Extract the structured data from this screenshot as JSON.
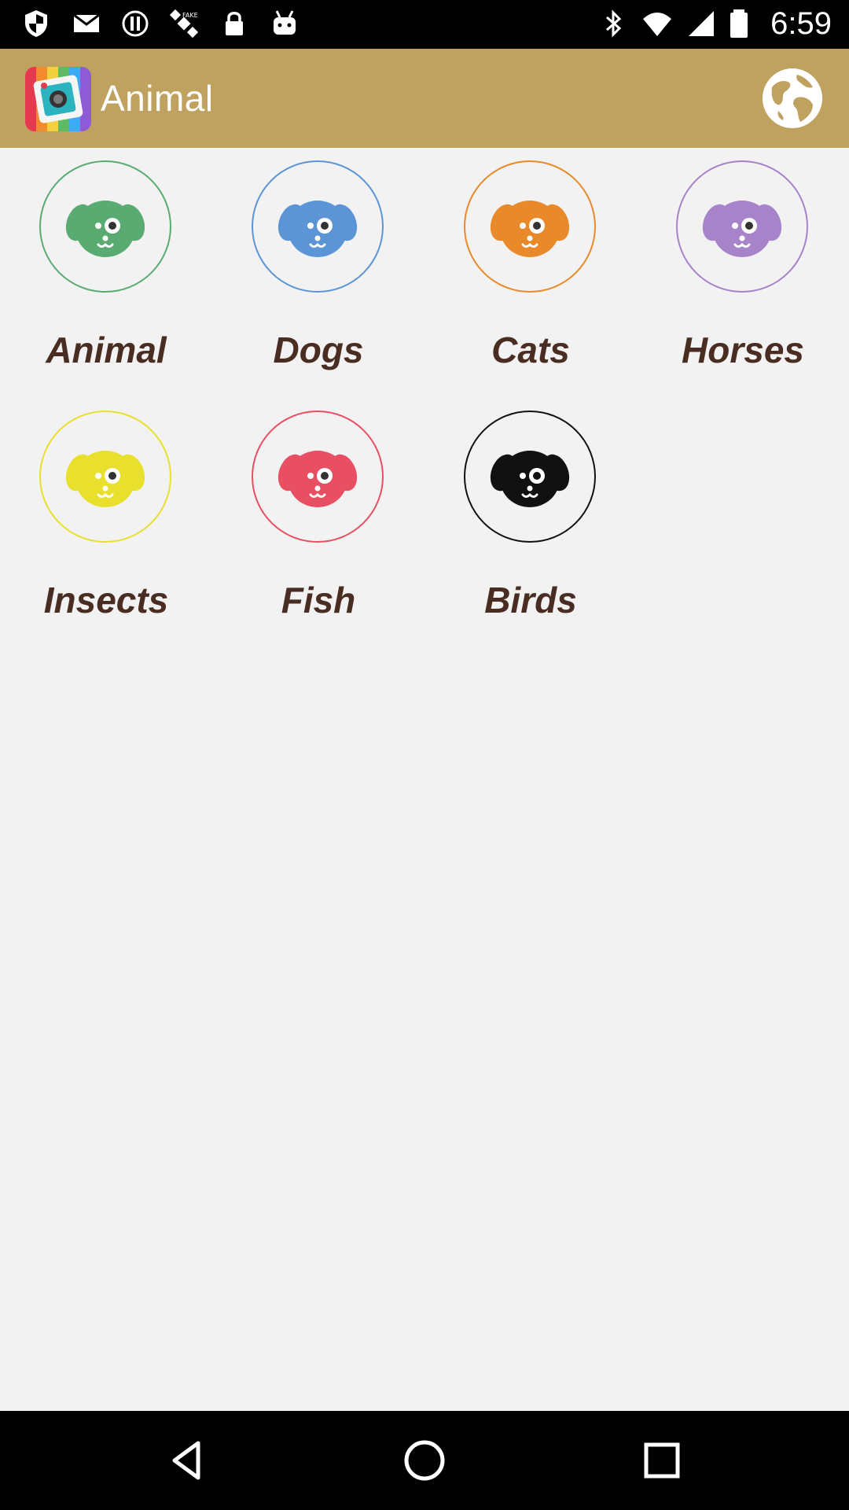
{
  "status_bar": {
    "time": "6:59",
    "left_icons": [
      "shield-icon",
      "mail-icon",
      "alert-circle-icon",
      "satellite-icon",
      "lock-icon",
      "android-icon"
    ],
    "right_icons": [
      "bluetooth-icon",
      "wifi-icon",
      "signal-icon",
      "battery-icon"
    ]
  },
  "app_bar": {
    "title": "Animal",
    "logo_icon": "camera-app-icon",
    "action_icon": "globe-icon",
    "background": "#bfa160"
  },
  "categories": [
    {
      "label": "Animal",
      "color": "#5aab72",
      "icon": "dog-face-icon"
    },
    {
      "label": "Dogs",
      "color": "#5b95d6",
      "icon": "dog-face-icon"
    },
    {
      "label": "Cats",
      "color": "#e8892a",
      "icon": "dog-face-icon"
    },
    {
      "label": "Horses",
      "color": "#a783c9",
      "icon": "dog-face-icon"
    },
    {
      "label": "Insects",
      "color": "#e8e02c",
      "icon": "dog-face-icon"
    },
    {
      "label": "Fish",
      "color": "#e84f62",
      "icon": "dog-face-icon"
    },
    {
      "label": "Birds",
      "color": "#111111",
      "icon": "dog-face-icon"
    }
  ],
  "nav_bar": {
    "back": "back-triangle-icon",
    "home": "home-circle-icon",
    "recents": "recents-square-icon"
  }
}
